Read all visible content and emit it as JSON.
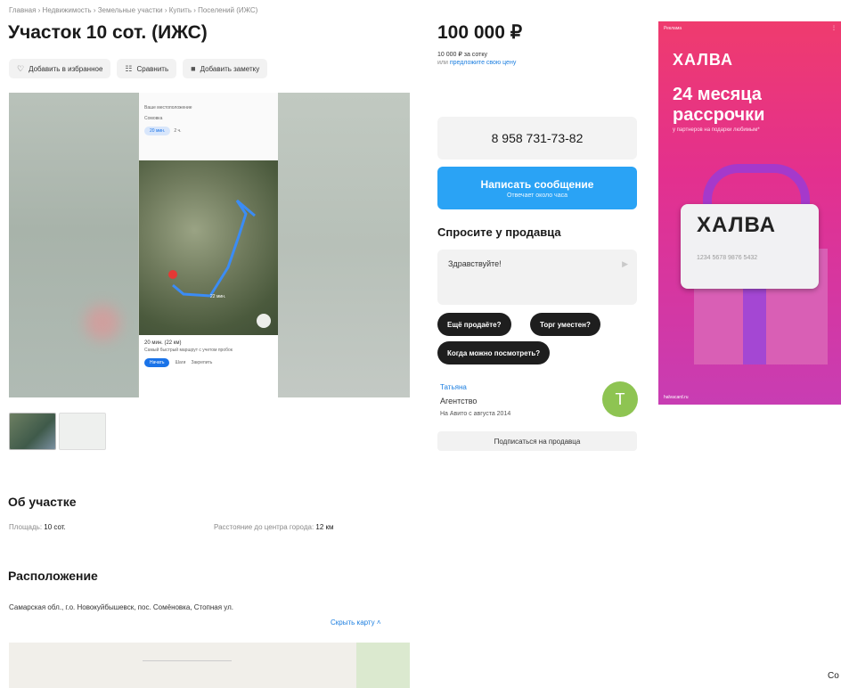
{
  "breadcrumbs": "Главная › Недвижимость › Земельные участки › Купить › Поселений (ИЖС)",
  "title": "Участок 10 сот. (ИЖС)",
  "actions": {
    "favorite": "Добавить в избранное",
    "compare": "Сравнить",
    "note": "Добавить заметку"
  },
  "icons": {
    "favorite": "♡",
    "compare": "☷",
    "note": "■",
    "send": "▶"
  },
  "gallery": {
    "phone_screen": {
      "route_from": "Ваше местоположение",
      "route_to": "Сомовка",
      "modes": [
        "20 мин.",
        "2 ч."
      ],
      "eta": "20 мин. (22 км)",
      "route_note": "Самый быстрый маршрут с учетом пробок",
      "start_button": "Начать",
      "steps": "Шаги",
      "save": "Закрепить",
      "map_label": "22 мин."
    }
  },
  "price": {
    "value": "100 000 ₽",
    "per_area": "10 000 ₽ за сотку",
    "offer_prefix": "или",
    "offer_link": "предложите свою цену"
  },
  "contact": {
    "phone": "8 958 731-73-82",
    "message_button": "Написать сообщение",
    "reply_time": "Отвечает около часа"
  },
  "ask": {
    "heading": "Спросите у продавца",
    "input_value": "Здравствуйте!",
    "chips": [
      "Ещё продаёте?",
      "Торг уместен?",
      "Когда можно посмотреть?"
    ]
  },
  "seller": {
    "name": "Татьяна",
    "type": "Агентство",
    "since": "На Авито с августа 2014",
    "avatar_letter": "Т",
    "avatar_color": "#8ec452",
    "subscribe": "Подписаться на продавца"
  },
  "ad": {
    "label": "Реклама",
    "brand": "ХАЛВА",
    "headline_1": "24 месяца",
    "headline_2": "рассрочки",
    "subtext": "у партнеров на подарки любимым*",
    "card_brand": "ХАЛВА",
    "card_number": "1234 5678 9876 5432",
    "domain": "halvacard.ru"
  },
  "about": {
    "heading": "Об участке",
    "area_label": "Площадь:",
    "area_value": "10 сот.",
    "distance_label": "Расстояние до центра города:",
    "distance_value": "12 км"
  },
  "location": {
    "heading": "Расположение",
    "address": "Самарская обл., г.о. Новокуйбышевск, пос. Сомёновка, Стопная ул.",
    "hide_map": "Скрыть карту ˄"
  },
  "corner_text": "Co",
  "colors": {
    "accent_blue": "#2aa3f5",
    "link_blue": "#1d7fe0",
    "ad_pink": "#ef3b6e",
    "chip_dark": "#1e1e1e"
  }
}
